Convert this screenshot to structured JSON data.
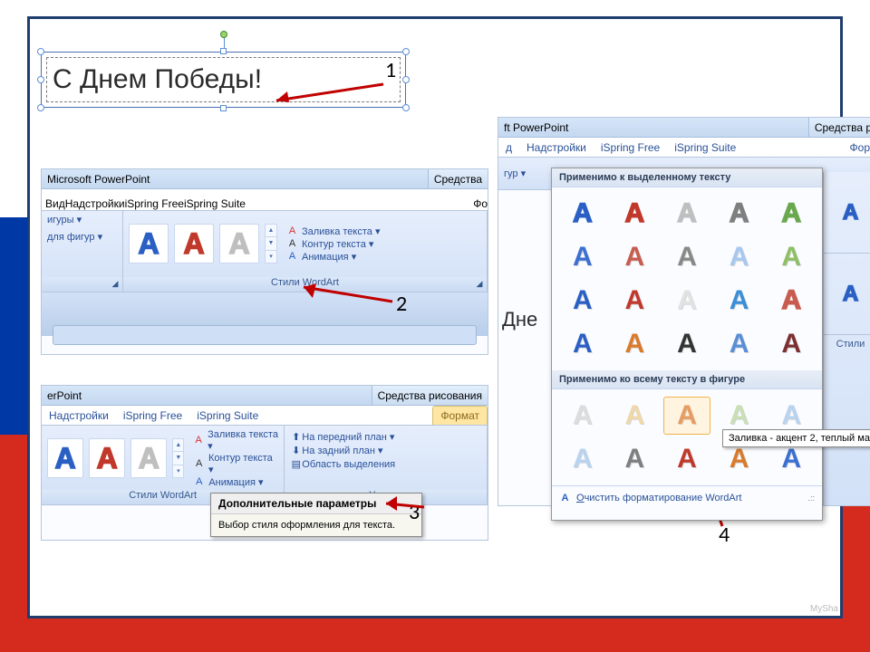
{
  "textbox": {
    "content": "С Днем Победы!"
  },
  "annotations": {
    "n1": "1",
    "n2": "2",
    "n3": "3",
    "n4": "4"
  },
  "s2": {
    "app_title": "Microsoft PowerPoint",
    "context_tab": "Средства",
    "tabs": {
      "t1": "Вид",
      "t2": "Надстройки",
      "t3": "iSpring Free",
      "t4": "iSpring Suite",
      "t5": "Фо"
    },
    "left_opts": {
      "o1": "игуры ▾",
      "o2": "для фигур ▾"
    },
    "text_opts": {
      "fill": "Заливка текста ▾",
      "outline": "Контур текста ▾",
      "anim": "Анимация ▾"
    },
    "group_label": "Стили WordArt"
  },
  "s3": {
    "app_title": "erPoint",
    "context_tab": "Средства рисования",
    "tabs": {
      "t1": "Надстройки",
      "t2": "iSpring Free",
      "t3": "iSpring Suite",
      "t4": "Формат"
    },
    "text_opts": {
      "fill": "Заливка текста ▾",
      "outline": "Контур текста ▾",
      "anim": "Анимация ▾"
    },
    "arrange": {
      "o1": "На передний план ▾",
      "o2": "На задний план ▾",
      "o3": "Область выделения"
    },
    "group_wa": "Стили WordArt",
    "group_arr": "Упоряд",
    "tooltip_title": "Дополнительные параметры",
    "tooltip_body": "Выбор стиля оформления для текста."
  },
  "s4": {
    "app_title": "ft PowerPoint",
    "context_tab": "Средства р",
    "tabs": {
      "t1": "д",
      "t2": "Надстройки",
      "t3": "iSpring Free",
      "t4": "iSpring Suite",
      "t5": "Фор"
    },
    "strip": {
      "o1": "гур ▾"
    },
    "dropdown_header1": "Применимо к выделенному тексту",
    "dropdown_header2": "Применимо ко всему тексту в фигуре",
    "clear": "Очистить форматирование WordArt",
    "clear_underline_char": "О",
    "preview_tip": "Заливка - акцент 2, теплый ма",
    "bg_text": "Дне",
    "right_label": "Стили"
  },
  "credit": "MySha",
  "glyph": "A"
}
